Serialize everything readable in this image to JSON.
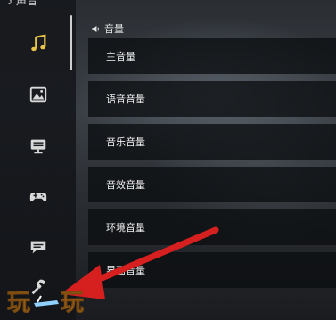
{
  "sidebar": {
    "header": "声音",
    "items": [
      {
        "icon": "music-note-icon",
        "active": true
      },
      {
        "icon": "image-icon",
        "active": false
      },
      {
        "icon": "display-icon",
        "active": false
      },
      {
        "icon": "gamepad-icon",
        "active": false
      },
      {
        "icon": "chat-icon",
        "active": false
      },
      {
        "icon": "wrench-icon",
        "active": false
      }
    ]
  },
  "section": {
    "title": "音量"
  },
  "volume_rows": [
    "主音量",
    "语音音量",
    "音乐音量",
    "音效音量",
    "环境音量",
    "界面音量"
  ],
  "watermark": {
    "text": "玩一玩"
  },
  "colors": {
    "accent_yellow": "#e8c44a",
    "arrow_red": "#d62020",
    "watermark_orange": "#e89a2a"
  }
}
